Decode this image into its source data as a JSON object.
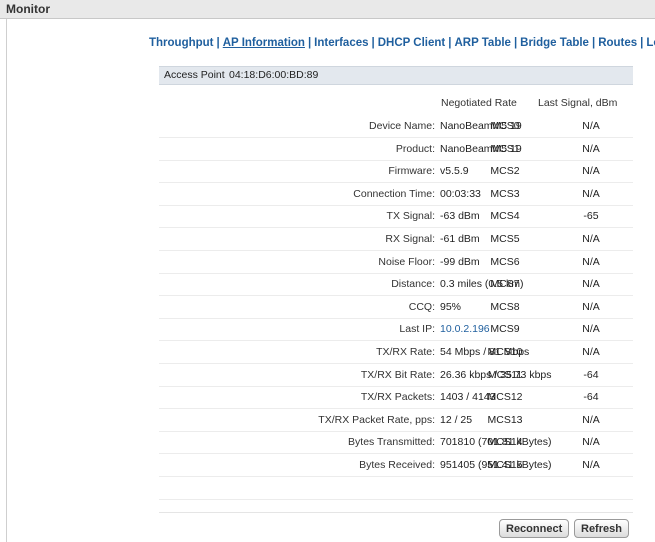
{
  "monitor": {
    "title": "Monitor"
  },
  "nav": {
    "items": [
      "Throughput",
      "AP Information",
      "Interfaces",
      "DHCP Client",
      "ARP Table",
      "Bridge Table",
      "Routes",
      "Log"
    ],
    "active": "AP Information",
    "separator": "|"
  },
  "access_point": {
    "label": "Access Point",
    "value": "04:18:D6:00:BD:89"
  },
  "table": {
    "headers": {
      "rate": "Negotiated Rate",
      "signal": "Last Signal, dBm"
    },
    "info": [
      {
        "label": "Device Name:",
        "value": "NanoBeamM5 19"
      },
      {
        "label": "Product:",
        "value": "NanoBeamM5 19"
      },
      {
        "label": "Firmware:",
        "value": "v5.5.9"
      },
      {
        "label": "Connection Time:",
        "value": "00:03:33"
      },
      {
        "label": "TX Signal:",
        "value": "-63 dBm"
      },
      {
        "label": "RX Signal:",
        "value": "-61 dBm"
      },
      {
        "label": "Noise Floor:",
        "value": "-99 dBm"
      },
      {
        "label": "Distance:",
        "value": "0.3 miles (0.5 km)"
      },
      {
        "label": "CCQ:",
        "value": "95%"
      },
      {
        "label": "Last IP:",
        "value": "10.0.2.196"
      },
      {
        "label": "TX/RX Rate:",
        "value": "54 Mbps / 81 Mbps"
      },
      {
        "label": "TX/RX Bit Rate:",
        "value": "26.36 kbps / 35.73 kbps"
      },
      {
        "label": "TX/RX Packets:",
        "value": "1403 / 4143"
      },
      {
        "label": "TX/RX Packet Rate, pps:",
        "value": "12 / 25"
      },
      {
        "label": "Bytes Transmitted:",
        "value": "701810 (701.81 kBytes)"
      },
      {
        "label": "Bytes Received:",
        "value": "951405 (951.41 kBytes)"
      },
      {
        "label": "",
        "value": ""
      }
    ],
    "rates": [
      {
        "rate": "MCS0",
        "signal": "N/A"
      },
      {
        "rate": "MCS1",
        "signal": "N/A"
      },
      {
        "rate": "MCS2",
        "signal": "N/A"
      },
      {
        "rate": "MCS3",
        "signal": "N/A"
      },
      {
        "rate": "MCS4",
        "signal": "-65"
      },
      {
        "rate": "MCS5",
        "signal": "N/A"
      },
      {
        "rate": "MCS6",
        "signal": "N/A"
      },
      {
        "rate": "MCS7",
        "signal": "N/A"
      },
      {
        "rate": "MCS8",
        "signal": "N/A"
      },
      {
        "rate": "MCS9",
        "signal": "N/A"
      },
      {
        "rate": "MCS10",
        "signal": "N/A"
      },
      {
        "rate": "MCS11",
        "signal": "-64"
      },
      {
        "rate": "MCS12",
        "signal": "-64"
      },
      {
        "rate": "MCS13",
        "signal": "N/A"
      },
      {
        "rate": "MCS14",
        "signal": "N/A"
      },
      {
        "rate": "MCS15",
        "signal": "N/A"
      }
    ]
  },
  "buttons": {
    "reconnect": "Reconnect",
    "refresh": "Refresh"
  }
}
